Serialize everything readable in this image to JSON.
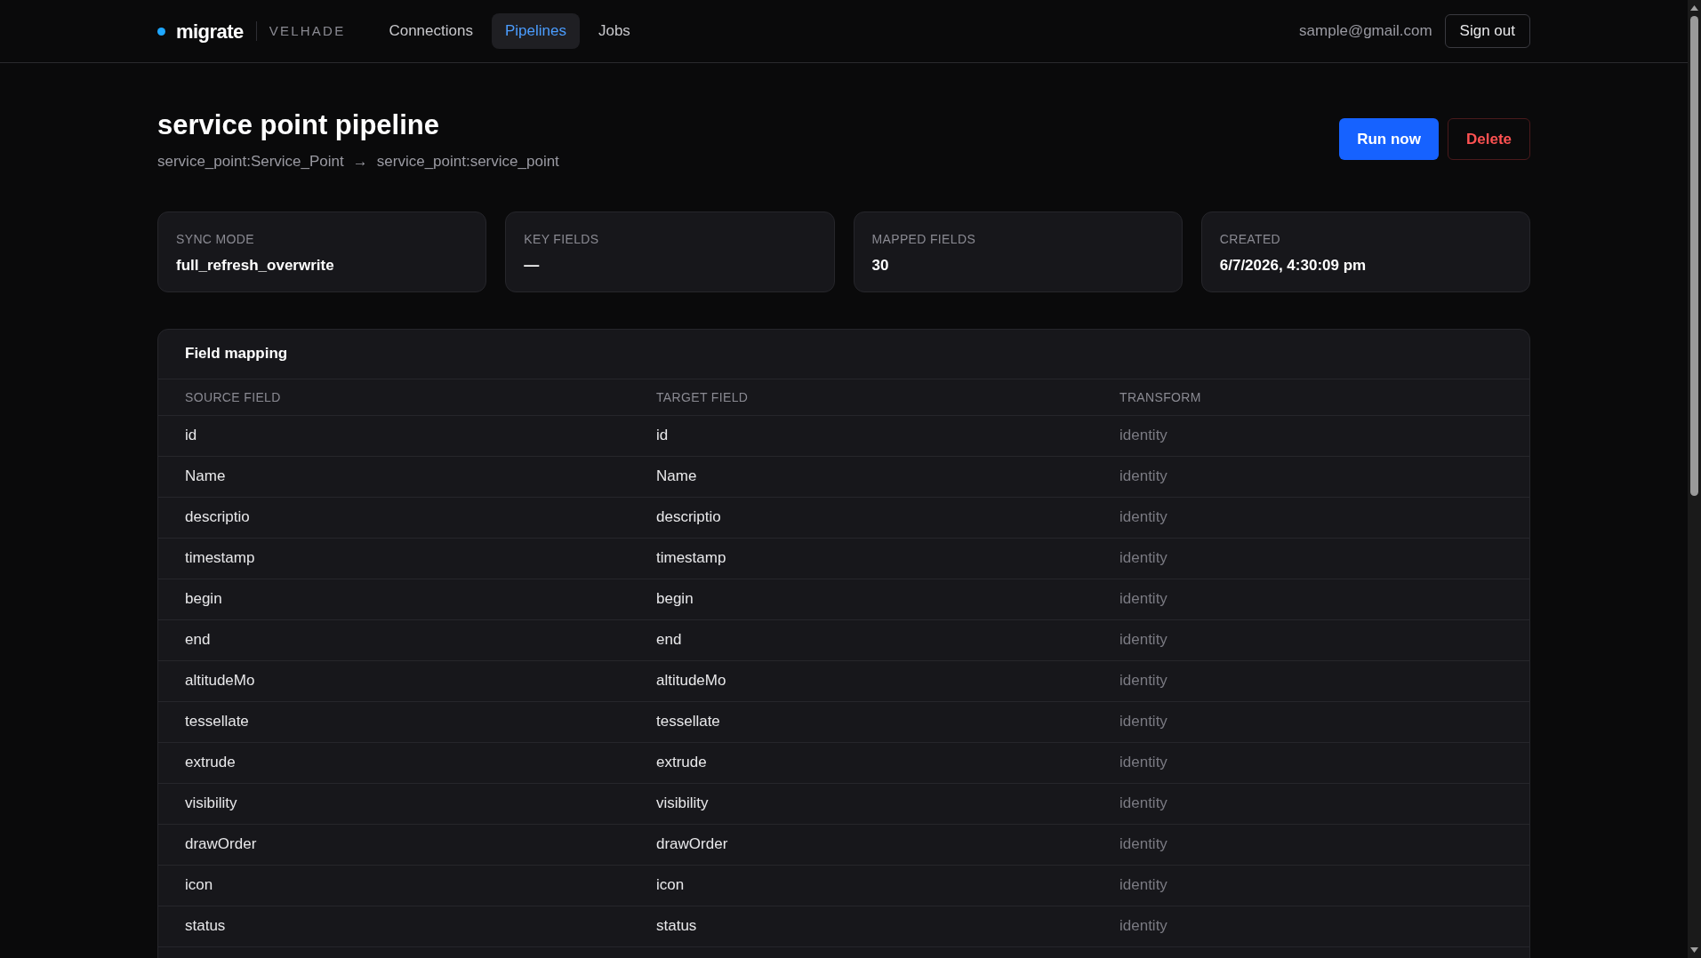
{
  "brand": {
    "name": "migrate",
    "workspace": "VELHADE"
  },
  "nav": [
    {
      "label": "Connections",
      "selected": false
    },
    {
      "label": "Pipelines",
      "selected": true
    },
    {
      "label": "Jobs",
      "selected": false
    }
  ],
  "user": {
    "email": "sample@gmail.com",
    "sign_out": "Sign out"
  },
  "pipeline": {
    "title": "service point pipeline",
    "source": "service_point:Service_Point",
    "arrow": "→",
    "target": "service_point:service_point"
  },
  "actions": [
    {
      "label": "Run now",
      "kind": "primary"
    },
    {
      "label": "Delete",
      "kind": "danger"
    }
  ],
  "stats": [
    {
      "label": "SYNC MODE",
      "value": "full_refresh_overwrite"
    },
    {
      "label": "KEY FIELDS",
      "value": "—"
    },
    {
      "label": "MAPPED FIELDS",
      "value": "30"
    },
    {
      "label": "CREATED",
      "value": "6/7/2026, 4:30:09 pm"
    }
  ],
  "field_mapping": {
    "title": "Field mapping",
    "columns": [
      "SOURCE FIELD",
      "TARGET FIELD",
      "TRANSFORM"
    ],
    "rows": [
      [
        "id",
        "id",
        "identity"
      ],
      [
        "Name",
        "Name",
        "identity"
      ],
      [
        "descriptio",
        "descriptio",
        "identity"
      ],
      [
        "timestamp",
        "timestamp",
        "identity"
      ],
      [
        "begin",
        "begin",
        "identity"
      ],
      [
        "end",
        "end",
        "identity"
      ],
      [
        "altitudeMo",
        "altitudeMo",
        "identity"
      ],
      [
        "tessellate",
        "tessellate",
        "identity"
      ],
      [
        "extrude",
        "extrude",
        "identity"
      ],
      [
        "visibility",
        "visibility",
        "identity"
      ],
      [
        "drawOrder",
        "drawOrder",
        "identity"
      ],
      [
        "icon",
        "icon",
        "identity"
      ],
      [
        "status",
        "status",
        "identity"
      ]
    ]
  }
}
